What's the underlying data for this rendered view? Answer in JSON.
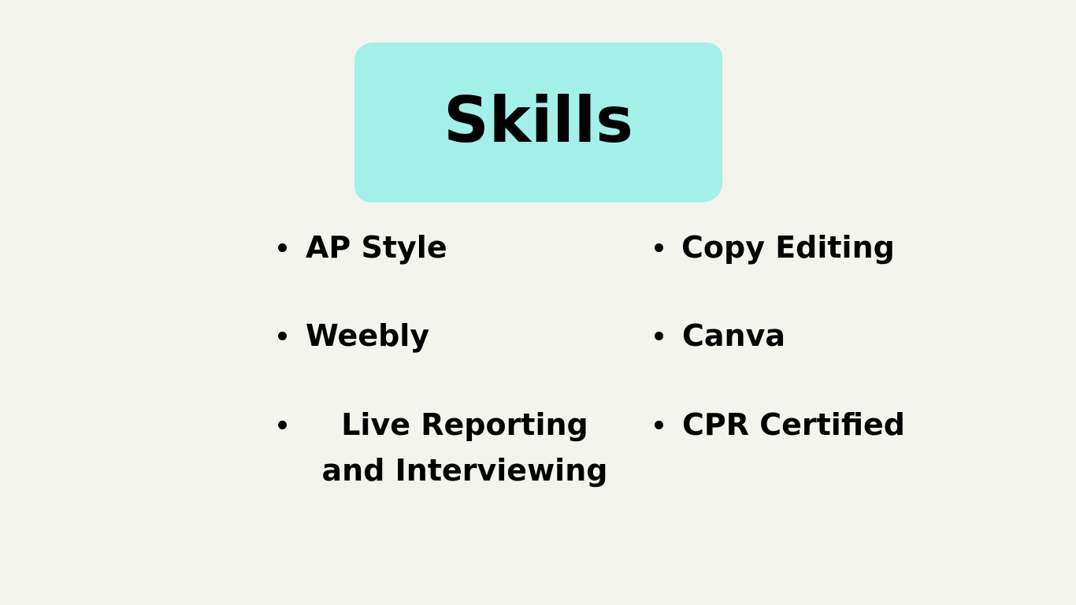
{
  "title": "Skills",
  "colors": {
    "background": "#f4f4ef",
    "title_box": "#a3f0e8",
    "text": "#000000"
  },
  "skills": {
    "left": [
      {
        "label": "AP Style"
      },
      {
        "label": "Weebly"
      },
      {
        "label": "Live Reporting and Interviewing"
      }
    ],
    "right": [
      {
        "label": "Copy Editing"
      },
      {
        "label": "Canva"
      },
      {
        "label": "CPR Certified"
      }
    ]
  }
}
